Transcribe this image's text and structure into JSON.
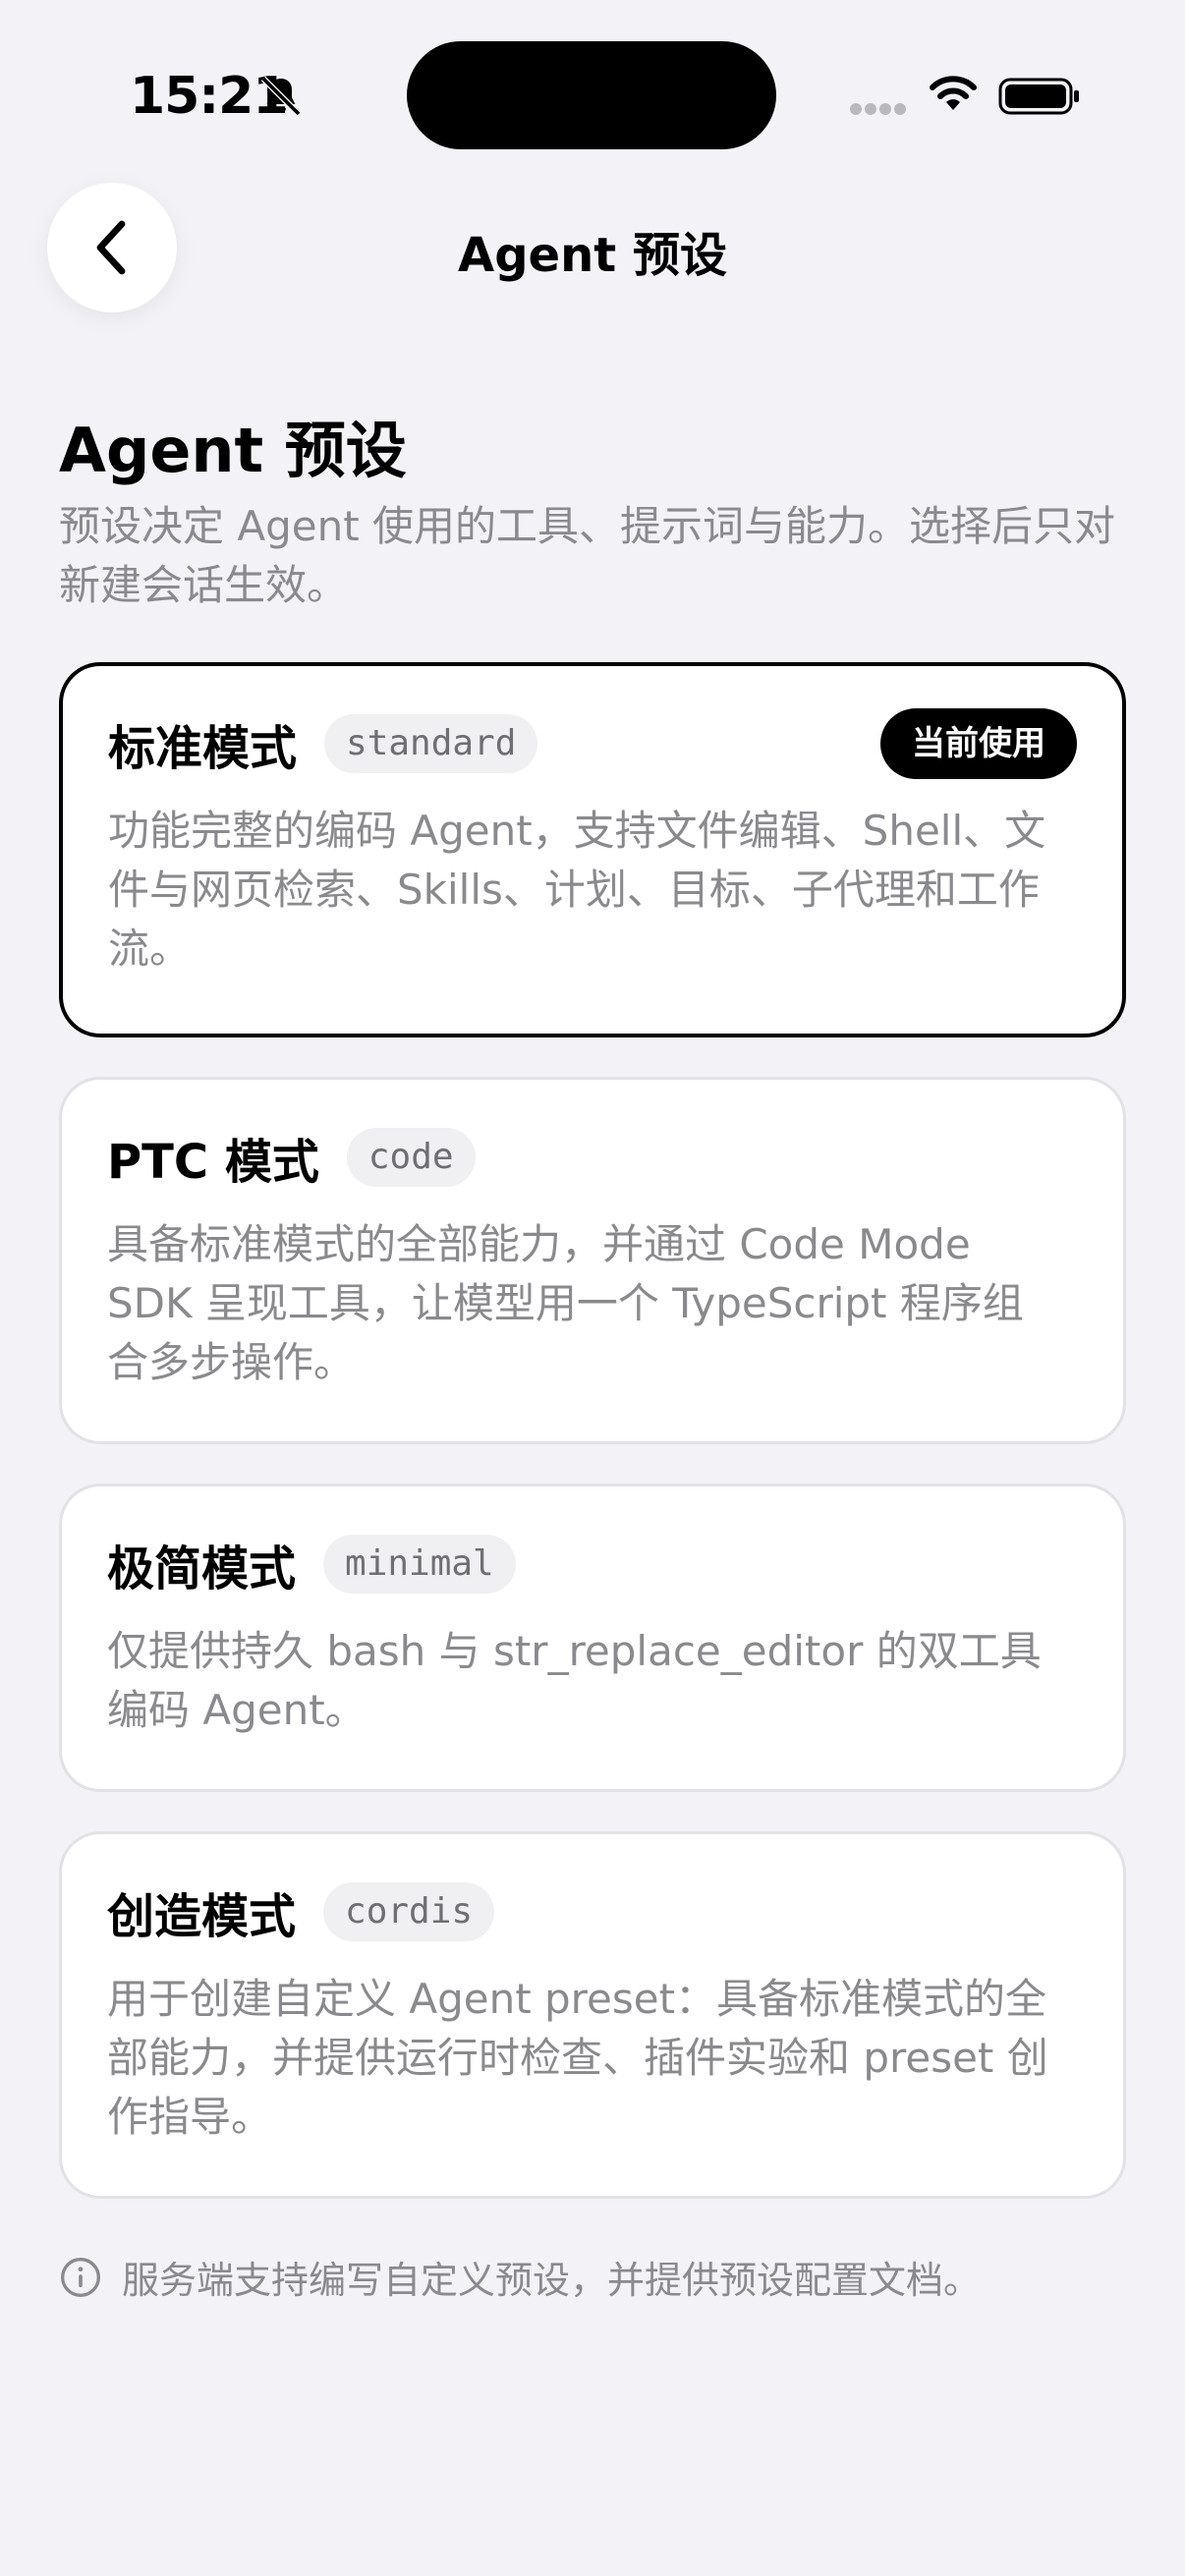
{
  "status": {
    "time": "15:21"
  },
  "nav": {
    "title": "Agent 预设"
  },
  "header": {
    "title": "Agent 预设",
    "description": "预设决定 Agent 使用的工具、提示词与能力。选择后只对新建会话生效。"
  },
  "presets": [
    {
      "name": "标准模式",
      "code": "standard",
      "badge": "当前使用",
      "description": "功能完整的编码 Agent，支持文件编辑、Shell、文件与网页检索、Skills、计划、目标、子代理和工作流。"
    },
    {
      "name": "PTC 模式",
      "code": "code",
      "description": "具备标准模式的全部能力，并通过 Code Mode SDK 呈现工具，让模型用一个 TypeScript 程序组合多步操作。"
    },
    {
      "name": "极简模式",
      "code": "minimal",
      "description": "仅提供持久 bash 与 str_replace_editor 的双工具编码 Agent。"
    },
    {
      "name": "创造模式",
      "code": "cordis",
      "description": "用于创建自定义 Agent preset：具备标准模式的全部能力，并提供运行时检查、插件实验和 preset 创作指导。"
    }
  ],
  "footnote": {
    "text": "服务端支持编写自定义预设，并提供预设配置文档。"
  },
  "colors": {
    "selected_border": "#000000",
    "muted_text": "#8a8a8e",
    "background": "#f2f2f7"
  }
}
